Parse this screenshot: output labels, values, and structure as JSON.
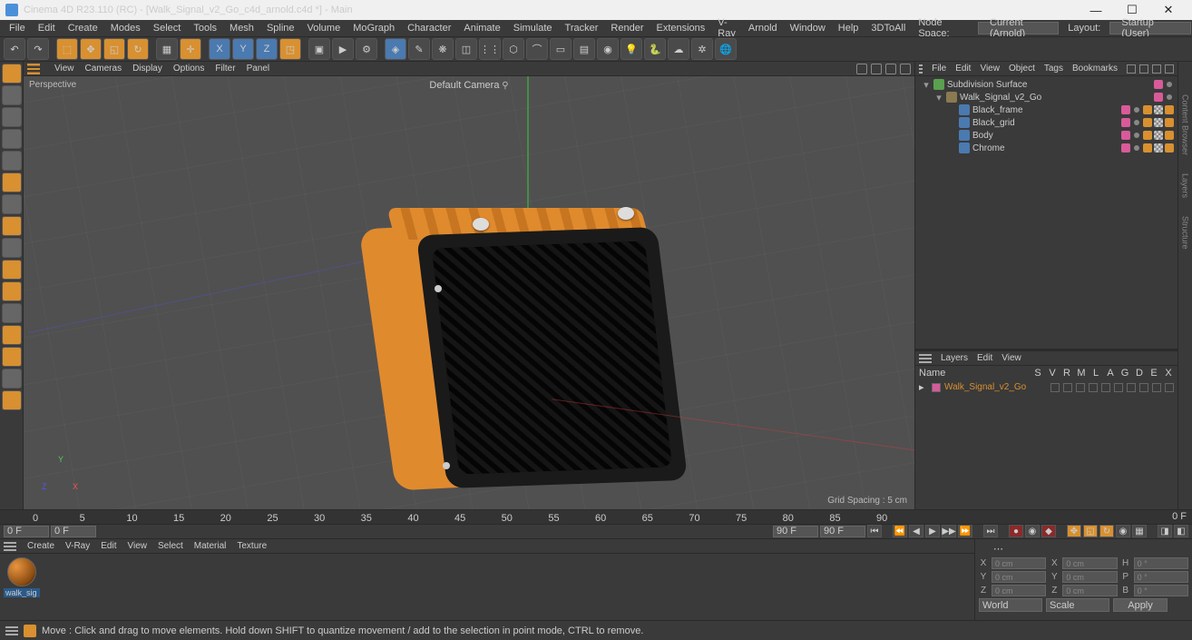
{
  "title": "Cinema 4D R23.110 (RC) - [Walk_Signal_v2_Go_c4d_arnold.c4d *] - Main",
  "menubar": [
    "File",
    "Edit",
    "Create",
    "Modes",
    "Select",
    "Tools",
    "Mesh",
    "Spline",
    "Volume",
    "MoGraph",
    "Character",
    "Animate",
    "Simulate",
    "Tracker",
    "Render",
    "Extensions",
    "V-Ray",
    "Arnold",
    "Window",
    "Help",
    "3DToAll"
  ],
  "nodespace_label": "Node Space:",
  "nodespace_value": "Current (Arnold)",
  "layout_label": "Layout:",
  "layout_value": "Startup (User)",
  "vpmenu": [
    "View",
    "Cameras",
    "Display",
    "Options",
    "Filter",
    "Panel"
  ],
  "vp_label": "Perspective",
  "vp_cam": "Default Camera",
  "vp_grid": "Grid Spacing : 5 cm",
  "objmenu": [
    "File",
    "Edit",
    "View",
    "Object",
    "Tags",
    "Bookmarks"
  ],
  "tree": [
    {
      "ind": 0,
      "name": "Subdivision Surface",
      "ico": "#5aa050",
      "tags": [
        "pk",
        "dot"
      ]
    },
    {
      "ind": 1,
      "name": "Walk_Signal_v2_Go",
      "ico": "#8a7a50",
      "tags": [
        "pk",
        "dot"
      ]
    },
    {
      "ind": 2,
      "name": "Black_frame",
      "ico": "#4a7ab0",
      "tags": [
        "pk",
        "dot",
        "or",
        "chk",
        "or"
      ]
    },
    {
      "ind": 2,
      "name": "Black_grid",
      "ico": "#4a7ab0",
      "tags": [
        "pk",
        "dot",
        "or",
        "chk",
        "or"
      ]
    },
    {
      "ind": 2,
      "name": "Body",
      "ico": "#4a7ab0",
      "tags": [
        "pk",
        "dot",
        "or",
        "chk",
        "or"
      ]
    },
    {
      "ind": 2,
      "name": "Chrome",
      "ico": "#4a7ab0",
      "tags": [
        "pk",
        "dot",
        "or",
        "chk",
        "or"
      ]
    }
  ],
  "laymenu": [
    "Layers",
    "Edit",
    "View"
  ],
  "layhead": {
    "name": "Name",
    "cols": [
      "S",
      "V",
      "R",
      "M",
      "L",
      "A",
      "G",
      "D",
      "E",
      "X"
    ]
  },
  "layer_name": "Walk_Signal_v2_Go",
  "timeline": {
    "ticks": [
      "0",
      "5",
      "10",
      "15",
      "20",
      "25",
      "30",
      "35",
      "40",
      "45",
      "50",
      "55",
      "60",
      "65",
      "70",
      "75",
      "80",
      "85",
      "90"
    ],
    "f0": "0 F",
    "f1": "0 F",
    "f2": "90 F",
    "f3": "90 F"
  },
  "matmenu": [
    "Create",
    "V-Ray",
    "Edit",
    "View",
    "Select",
    "Material",
    "Texture"
  ],
  "mat_name": "walk_sig",
  "coords": {
    "r1": [
      {
        "l": "X",
        "v": "0 cm"
      },
      {
        "l": "X",
        "v": "0 cm"
      },
      {
        "l": "H",
        "v": "0 °"
      }
    ],
    "r2": [
      {
        "l": "Y",
        "v": "0 cm"
      },
      {
        "l": "Y",
        "v": "0 cm"
      },
      {
        "l": "P",
        "v": "0 °"
      }
    ],
    "r3": [
      {
        "l": "Z",
        "v": "0 cm"
      },
      {
        "l": "Z",
        "v": "0 cm"
      },
      {
        "l": "B",
        "v": "0 °"
      }
    ],
    "world": "World",
    "scale": "Scale",
    "apply": "Apply"
  },
  "status": "Move : Click and drag to move elements. Hold down SHIFT to quantize movement / add to the selection in point mode, CTRL to remove.",
  "vtabs": [
    "Content Browser",
    "Layers",
    "Structure"
  ]
}
